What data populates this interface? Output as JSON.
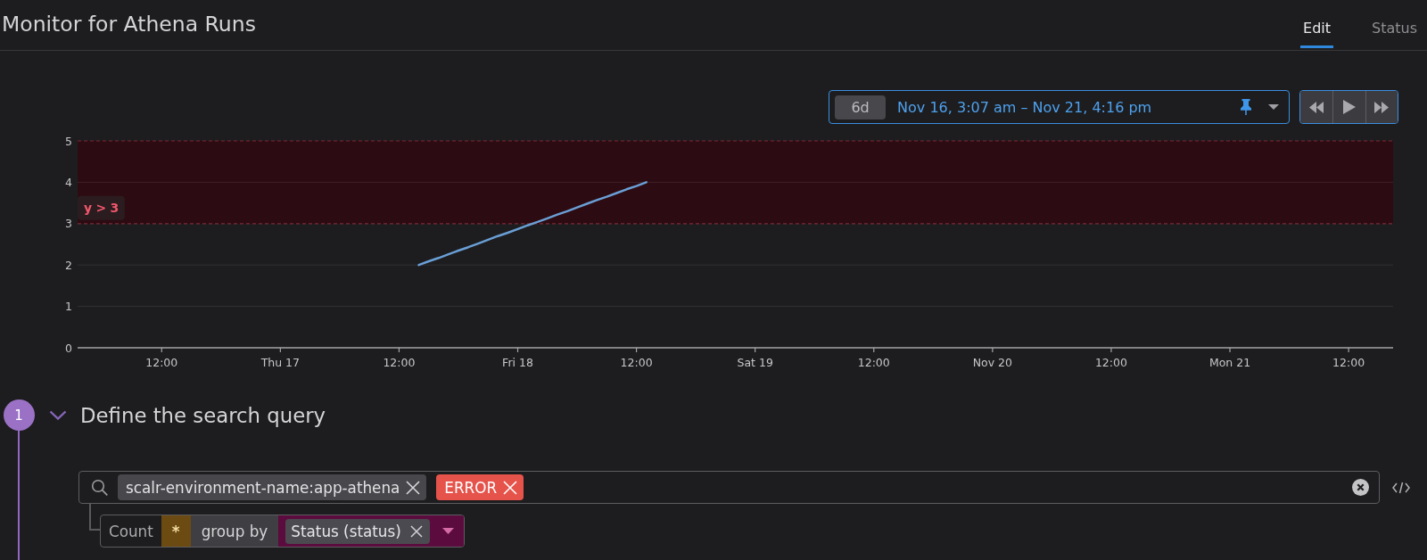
{
  "header": {
    "title": "Monitor for Athena Runs",
    "tabs": [
      {
        "label": "Edit",
        "selected": true
      },
      {
        "label": "Status",
        "selected": false
      }
    ]
  },
  "time_picker": {
    "duration": "6d",
    "range": "Nov 16, 3:07 am – Nov 21, 4:16 pm"
  },
  "chart": {
    "chart_data": {
      "type": "line",
      "categories": [
        null,
        null,
        null,
        null,
        null,
        null,
        null,
        null,
        "12:00",
        null,
        null,
        null,
        null,
        null,
        null,
        null,
        null,
        null,
        null,
        null,
        "Thu 17",
        null,
        null,
        null,
        null,
        null,
        null,
        null,
        null,
        null,
        null,
        null,
        "12:00",
        null,
        null,
        null,
        null,
        null,
        null,
        null,
        null,
        null,
        null,
        null,
        "Fri 18",
        null,
        null,
        null,
        null,
        null,
        null,
        null,
        null,
        null,
        null,
        null,
        "12:00",
        null,
        null,
        null,
        null,
        null,
        null,
        null,
        null,
        null,
        null,
        null,
        "Sat 19",
        null,
        null,
        null,
        null,
        null,
        null,
        null,
        null,
        null,
        null,
        null,
        "12:00",
        null,
        null,
        null,
        null,
        null,
        null,
        null,
        null,
        null,
        null,
        null,
        "Nov 20",
        null,
        null,
        null,
        null,
        null,
        null,
        null,
        null,
        null,
        null,
        null,
        "12:00",
        null,
        null,
        null,
        null,
        null,
        null,
        null,
        null,
        null,
        null,
        null,
        "Mon 21",
        null,
        null,
        null,
        null,
        null,
        null,
        null,
        null,
        null,
        null,
        null,
        "12:00",
        null,
        null,
        null,
        null
      ],
      "series": [
        {
          "color": "#6a9fd6",
          "values": [
            null,
            null,
            null,
            null,
            null,
            null,
            null,
            null,
            null,
            null,
            null,
            null,
            null,
            null,
            null,
            null,
            null,
            null,
            null,
            null,
            null,
            null,
            null,
            null,
            null,
            null,
            null,
            null,
            null,
            null,
            null,
            null,
            null,
            null,
            2,
            2.09,
            2.17,
            2.26,
            2.35,
            2.43,
            2.52,
            2.61,
            2.7,
            2.78,
            2.87,
            2.96,
            3.04,
            3.13,
            3.22,
            3.3,
            3.39,
            3.48,
            3.57,
            3.65,
            3.74,
            3.83,
            3.91,
            4,
            null,
            null,
            null,
            null,
            null,
            null,
            null,
            null,
            null,
            null,
            null,
            null,
            null,
            null,
            null,
            null,
            null,
            null,
            null,
            null,
            null,
            null,
            null,
            null,
            null,
            null,
            null,
            null,
            null,
            null,
            null,
            null,
            null,
            null,
            null,
            null,
            null,
            null,
            null,
            null,
            null,
            null,
            null,
            null,
            null,
            null,
            null,
            null,
            null,
            null,
            null,
            null,
            null,
            null,
            null,
            null,
            null,
            null,
            null,
            null,
            null,
            null,
            null,
            null,
            null,
            null,
            null,
            null,
            null,
            null,
            null,
            null,
            null,
            null,
            null
          ]
        }
      ],
      "ylim": [
        0,
        5
      ],
      "yticks": [
        0,
        1,
        2,
        3,
        4,
        5
      ],
      "grid": true,
      "bands": [
        {
          "axis": "y",
          "from": 3,
          "to": 5,
          "color": "#2d0b12",
          "label": "y > 3"
        }
      ],
      "ref_lines": [
        {
          "axis": "y",
          "value": 3,
          "color": "#7a2a35"
        },
        {
          "axis": "y",
          "value": 5,
          "color": "#7a2a35"
        }
      ]
    }
  },
  "step": {
    "number": "1",
    "expanded": true,
    "title": "Define the search query",
    "search": {
      "tags": [
        {
          "kind": "facet",
          "text": "scalr-environment-name:app-athena"
        },
        {
          "kind": "error",
          "text": "ERROR"
        }
      ]
    },
    "query": {
      "aggregation": "Count",
      "field": "*",
      "group_by_label": "group by",
      "groups": [
        {
          "text": "Status (status)"
        }
      ]
    }
  }
}
